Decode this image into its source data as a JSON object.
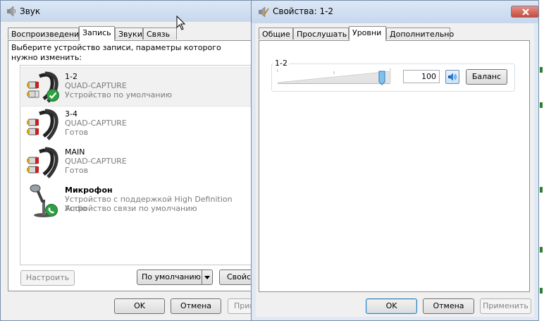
{
  "sound_window": {
    "title": "Звук",
    "tabs": [
      {
        "label": "Воспроизведение",
        "active": false
      },
      {
        "label": "Запись",
        "active": true
      },
      {
        "label": "Звуки",
        "active": false
      },
      {
        "label": "Связь",
        "active": false
      }
    ],
    "instruction": "Выберите устройство записи, параметры которого нужно изменить:",
    "devices": [
      {
        "name": "1-2",
        "subtitle": "QUAD-CAPTURE",
        "status": "Устройство по умолчанию",
        "icon": "rca-cable-icon",
        "badge": "default-check-icon",
        "selected": true
      },
      {
        "name": "3-4",
        "subtitle": "QUAD-CAPTURE",
        "status": "Готов",
        "icon": "rca-cable-icon",
        "badge": "",
        "selected": false
      },
      {
        "name": "MAIN",
        "subtitle": "QUAD-CAPTURE",
        "status": "Готов",
        "icon": "rca-cable-icon",
        "badge": "",
        "selected": false
      },
      {
        "name": "Микрофон",
        "subtitle": "Устройство с поддержкой High Definition Audio",
        "status": "Устройство связи по умолчанию",
        "icon": "microphone-icon",
        "badge": "phone-badge-icon",
        "selected": false
      }
    ],
    "buttons": {
      "configure": "Настроить",
      "set_default": "По умолчанию",
      "properties": "Свойс",
      "ok": "OK",
      "cancel": "Отмена",
      "apply": "Прим"
    }
  },
  "properties_window": {
    "title": "Свойства: 1-2",
    "tabs": [
      {
        "label": "Общие",
        "active": false
      },
      {
        "label": "Прослушать",
        "active": false
      },
      {
        "label": "Уровни",
        "active": true
      },
      {
        "label": "Дополнительно",
        "active": false
      }
    ],
    "level": {
      "label": "1-2",
      "value": "100",
      "fraction": 1.0,
      "balance_label": "Баланс",
      "speaker_icon": "speaker-icon"
    },
    "buttons": {
      "ok": "OK",
      "cancel": "Отмена",
      "apply": "Применить"
    },
    "close_icon": "close-icon"
  },
  "colors": {
    "accent_green": "#2ea043",
    "title_gradient_top": "#dbe7f5",
    "close_red": "#c94a3b"
  }
}
